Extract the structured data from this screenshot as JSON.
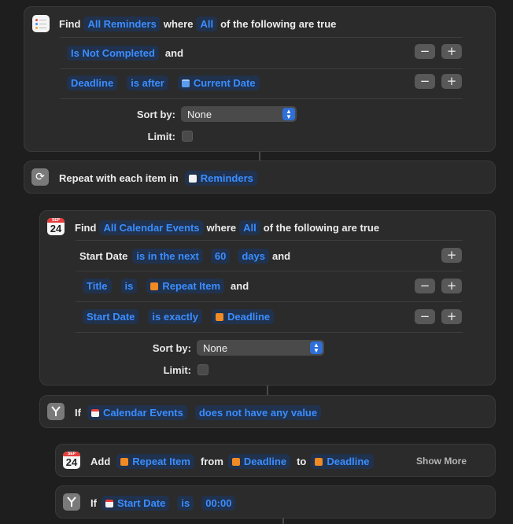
{
  "find_reminders": {
    "find": "Find",
    "source": "All Reminders",
    "where": "where",
    "quantifier": "All",
    "rest": "of the following are true",
    "cond1": {
      "value": "Is Not Completed",
      "tail": "and"
    },
    "cond2": {
      "field": "Deadline",
      "op": "is after",
      "value": "Current Date"
    },
    "sort_label": "Sort by:",
    "sort_value": "None",
    "limit_label": "Limit:"
  },
  "repeat": {
    "label": "Repeat with each item in",
    "variable": "Reminders"
  },
  "find_events": {
    "find": "Find",
    "source": "All Calendar Events",
    "where": "where",
    "quantifier": "All",
    "rest": "of the following are true",
    "cond1": {
      "field": "Start Date",
      "op": "is in the next",
      "num": "60",
      "unit": "days",
      "tail": "and"
    },
    "cond2": {
      "field": "Title",
      "op": "is",
      "value": "Repeat Item",
      "tail": "and"
    },
    "cond3": {
      "field": "Start Date",
      "op": "is exactly",
      "value": "Deadline"
    },
    "sort_label": "Sort by:",
    "sort_value": "None",
    "limit_label": "Limit:",
    "cal_month": "SEP",
    "cal_day": "24"
  },
  "if1": {
    "label": "If",
    "variable": "Calendar Events",
    "condition": "does not have any value"
  },
  "add": {
    "label": "Add",
    "item": "Repeat Item",
    "from": "from",
    "start": "Deadline",
    "to": "to",
    "end": "Deadline",
    "show_more": "Show More",
    "cal_month": "SEP",
    "cal_day": "24"
  },
  "if2": {
    "label": "If",
    "variable": "Start Date",
    "op": "is",
    "value": "00:00"
  },
  "buttons": {
    "minus": "−",
    "plus": "+"
  },
  "colors": {
    "accent": "#3c8dff",
    "background": "#1e1e1e",
    "card": "#2b2b2b"
  }
}
